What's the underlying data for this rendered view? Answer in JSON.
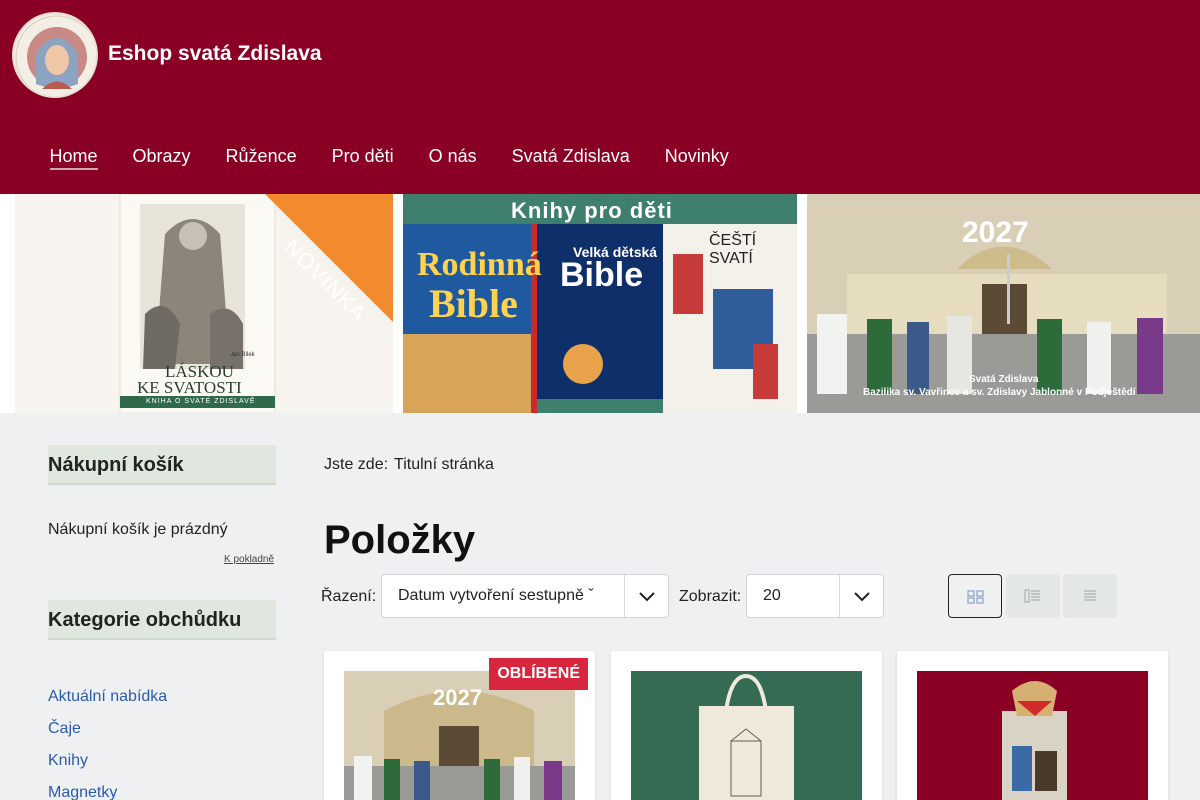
{
  "site": {
    "title": "Eshop svatá Zdislava"
  },
  "nav": [
    "Home",
    "Obrazy",
    "Růžence",
    "Pro děti",
    "O nás",
    "Svatá Zdislava",
    "Novinky"
  ],
  "banner": {
    "b1": {
      "ribbon": "NOVINKA",
      "book_title_1": "LÁSKOU",
      "book_title_2": "KE SVATOSTI",
      "book_subtitle": "KNIHA O SVATÉ ZDISLAVĚ",
      "author": "Jan Bílek"
    },
    "b2": {
      "heading": "Knihy pro děti",
      "book1_1": "Rodinná",
      "book1_2": "Bible",
      "book2_1": "Velká dětská",
      "book2_2": "Bible",
      "book3": "ČEŠTÍ SVATÍ"
    },
    "b3": {
      "year": "2027",
      "caption_1": "Svatá Zdislava",
      "caption_2": "Bazilika sv. Vavřince a sv. Zdislavy Jablonné v Podještědí"
    }
  },
  "sidebar": {
    "cart_title": "Nákupní košík",
    "cart_empty": "Nákupní košík je prázdný",
    "checkout": "K pokladně",
    "categories_title": "Kategorie obchůdku",
    "categories": [
      "Aktuální nabídka",
      "Čaje",
      "Knihy",
      "Magnetky"
    ]
  },
  "main": {
    "breadcrumb_label": "Jste zde:",
    "breadcrumb_current": "Titulní stránka",
    "title": "Položky",
    "sort_label": "Řazení:",
    "sort_value": "Datum vytvoření sestupně ˇ",
    "show_label": "Zobrazit:",
    "show_value": "20",
    "cards": [
      {
        "badge": "OBLÍBENÉ",
        "year": "2027"
      }
    ]
  },
  "colors": {
    "brand": "#8a0024",
    "link": "#2a5bb0",
    "badge": "#d7263d",
    "sidebar_title_bg": "#dfe7de"
  }
}
